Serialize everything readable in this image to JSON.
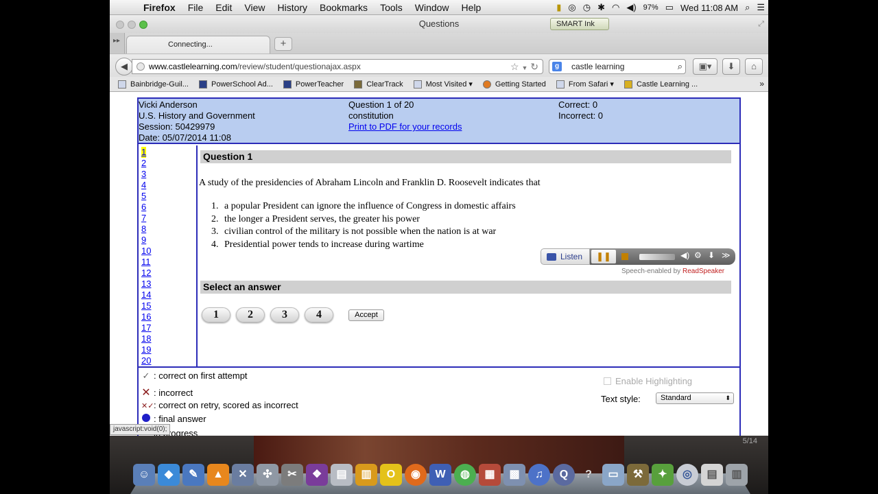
{
  "menubar": {
    "app": "Firefox",
    "items": [
      "File",
      "Edit",
      "View",
      "History",
      "Bookmarks",
      "Tools",
      "Window",
      "Help"
    ],
    "battery": "97%",
    "clock": "Wed 11:08 AM"
  },
  "window": {
    "title": "Questions",
    "smart_ink": "SMART Ink"
  },
  "tab": {
    "label": "Connecting...",
    "new_tab": "+"
  },
  "nav": {
    "url_domain": "www.castlelearning.com",
    "url_path": "/review/student/questionajax.aspx",
    "search_value": "castle learning"
  },
  "bookmarks": [
    "Bainbridge-Guil...",
    "PowerSchool Ad...",
    "PowerTeacher",
    "ClearTrack",
    "Most Visited",
    "Getting Started",
    "From Safari",
    "Castle Learning ..."
  ],
  "header": {
    "student": "Vicki Anderson",
    "course": "U.S. History and Government",
    "session": "Session: 50429979",
    "date": "Date: 05/07/2014 11:08",
    "question_of": "Question 1 of 20",
    "topic": "constitution",
    "print_link": "Print to PDF for your records",
    "correct": "Correct: 0",
    "incorrect": "Incorrect: 0"
  },
  "question_numbers": [
    "1",
    "2",
    "3",
    "4",
    "5",
    "6",
    "7",
    "8",
    "9",
    "10",
    "11",
    "12",
    "13",
    "14",
    "15",
    "16",
    "17",
    "18",
    "19",
    "20"
  ],
  "question": {
    "heading": "Question 1",
    "text": "A study of the presidencies of Abraham Lincoln and Franklin D. Roosevelt indicates that",
    "options": [
      {
        "num": "1.",
        "text": "a popular President can ignore the influence of Congress in domestic affairs"
      },
      {
        "num": "2.",
        "text": "the longer a President serves, the greater his power"
      },
      {
        "num": "3.",
        "text": "civilian control of the military is not possible when the nation is at war"
      },
      {
        "num": "4.",
        "text": "Presidential power tends to increase during wartime"
      }
    ]
  },
  "readspeaker": {
    "listen": "Listen",
    "credit_prefix": "Speech-enabled by ",
    "brand": "ReadSpeaker"
  },
  "answer": {
    "heading": "Select an answer",
    "buttons": [
      "1",
      "2",
      "3",
      "4"
    ],
    "accept": "Accept"
  },
  "legend": {
    "first": ": correct on first attempt",
    "incorrect": ": incorrect",
    "retry": ": correct on retry, scored as incorrect",
    "final": ": final answer",
    "progress": "in progress"
  },
  "options_panel": {
    "highlight": "Enable Highlighting",
    "text_style_label": "Text style:",
    "text_style_value": "Standard"
  },
  "status_bar": "javascript:void(0);",
  "slide_counter": "5/14"
}
